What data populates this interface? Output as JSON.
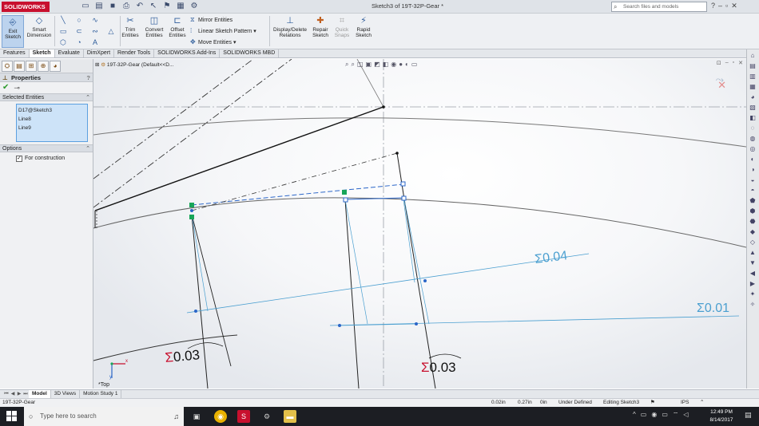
{
  "app": {
    "brand": "SOLIDWORKS",
    "document_title": "Sketch3 of 19T-32P-Gear *",
    "search_placeholder": "Search files and models"
  },
  "ribbon": {
    "exit_sketch": [
      "Exit",
      "Sketch"
    ],
    "smart_dimension": [
      "Smart",
      "Dimension"
    ],
    "trim_entities": [
      "Trim",
      "Entities"
    ],
    "convert_entities": [
      "Convert",
      "Entities"
    ],
    "offset_entities": [
      "Offset",
      "Entities"
    ],
    "mirror_entities": "Mirror Entities",
    "linear_sketch_pattern": "Linear Sketch Pattern",
    "move_entities": "Move Entities",
    "display_delete_relations": [
      "Display/Delete",
      "Relations"
    ],
    "repair_sketch": [
      "Repair",
      "Sketch"
    ],
    "quick_snaps": [
      "Quick",
      "Snaps"
    ],
    "rapid_sketch": [
      "Rapid",
      "Sketch"
    ]
  },
  "cm_tabs": [
    "Features",
    "Sketch",
    "Evaluate",
    "DimXpert",
    "Render Tools",
    "SOLIDWORKS Add-Ins",
    "SOLIDWORKS MBD"
  ],
  "property_manager": {
    "title": "Properties",
    "selected_header": "Selected Entities",
    "selected_entities": [
      "D17@Sketch3",
      "Line8",
      "Line9"
    ],
    "options_header": "Options",
    "for_construction": "For construction"
  },
  "graphics": {
    "tree_flyout": "19T-32P-Gear  (Default<<D...",
    "dims": {
      "d1": "0.04",
      "d2": "0.01",
      "d3": "0.03",
      "d4": "0.03"
    },
    "view_label": "*Top",
    "triad_x": "x",
    "triad_y": "y"
  },
  "model_tabs": [
    "Model",
    "3D Views",
    "Motion Study 1"
  ],
  "status": {
    "part_name": "19T-32P-Gear",
    "x": "0.02in",
    "y": "0.27in",
    "z": "0in",
    "state": "Under Defined",
    "editing": "Editing Sketch3",
    "units": "IPS"
  },
  "taskbar": {
    "search_placeholder": "Type here to search",
    "time": "12:49 PM",
    "date": "8/14/2017"
  },
  "colors": {
    "dim_blue": "#4a9fd0",
    "accent_red": "#c8102e",
    "selected_green": "#18a558"
  }
}
